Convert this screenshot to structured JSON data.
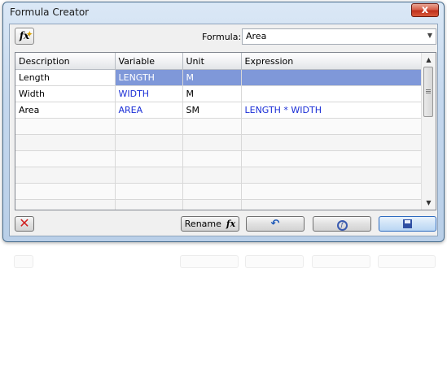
{
  "window": {
    "title": "Formula Creator",
    "close_label": "x"
  },
  "toolbar": {
    "insert_function_label": "fx",
    "formula_label": "Formula:",
    "formula_value": "Area"
  },
  "grid": {
    "columns": [
      "Description",
      "Variable",
      "Unit",
      "Expression"
    ],
    "rows": [
      {
        "description": "Length",
        "variable": "LENGTH",
        "unit": "M",
        "expression": ""
      },
      {
        "description": "Width",
        "variable": "WIDTH",
        "unit": "M",
        "expression": ""
      },
      {
        "description": "Area",
        "variable": "AREA",
        "unit": "SM",
        "expression": "LENGTH * WIDTH"
      }
    ],
    "selected_row_index": 0
  },
  "buttons": {
    "delete_label": "✕",
    "rename_label": "Rename",
    "rename_icon": "fx"
  },
  "colors": {
    "selection": "#7f98d9",
    "variable_text": "#1a2ed6",
    "close_button": "#c0301c"
  }
}
